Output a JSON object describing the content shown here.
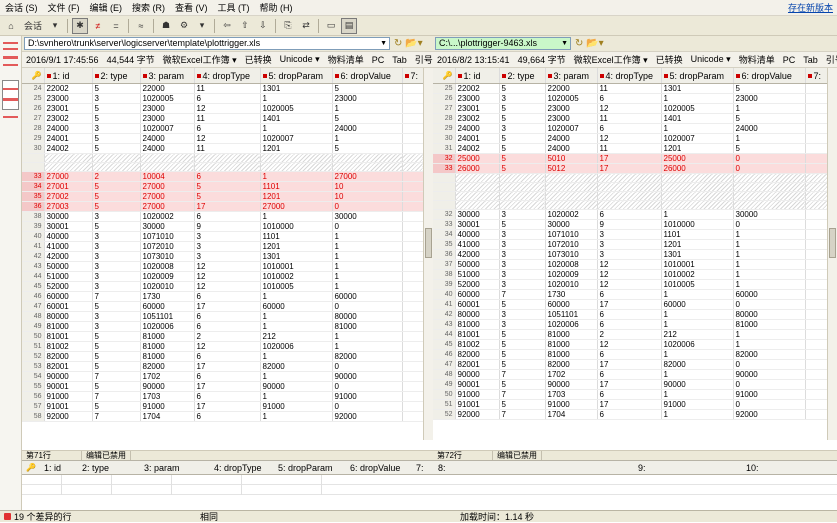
{
  "menu": {
    "items": [
      "会话 (S)",
      "文件 (F)",
      "编辑 (E)",
      "搜索 (R)",
      "查看 (V)",
      "工具 (T)",
      "帮助 (H)"
    ],
    "new_version": "存在新版本"
  },
  "toolbar": {
    "session_label": "会话"
  },
  "left": {
    "path": "D:\\svnhero\\trunk\\server\\logicserver\\template\\plottrigger.xls",
    "info": [
      "2016/9/1 17:45:56",
      "44,544 字节",
      "微软Excel工作簿 ▾",
      "已转换",
      "Unicode ▾",
      "物料清单",
      "PC",
      "Tab",
      "引号",
      "列"
    ],
    "columns": [
      "1: id",
      "2: type",
      "3: param",
      "4: dropType",
      "5: dropParam",
      "6: dropValue",
      "7:"
    ],
    "rows": [
      {
        "n": "24",
        "c": [
          "22002",
          "5",
          "22000",
          "11",
          "1301",
          "5",
          ""
        ]
      },
      {
        "n": "25",
        "c": [
          "23000",
          "3",
          "1020005",
          "6",
          "1",
          "23000",
          ""
        ]
      },
      {
        "n": "26",
        "c": [
          "23001",
          "5",
          "23000",
          "12",
          "1020005",
          "1",
          ""
        ]
      },
      {
        "n": "27",
        "c": [
          "23002",
          "5",
          "23000",
          "11",
          "1401",
          "5",
          ""
        ]
      },
      {
        "n": "28",
        "c": [
          "24000",
          "3",
          "1020007",
          "6",
          "1",
          "24000",
          ""
        ]
      },
      {
        "n": "29",
        "c": [
          "24001",
          "5",
          "24000",
          "12",
          "1020007",
          "1",
          ""
        ]
      },
      {
        "n": "30",
        "c": [
          "24002",
          "5",
          "24000",
          "11",
          "1201",
          "5",
          ""
        ]
      },
      {
        "n": "",
        "c": [
          "",
          "",
          "",
          "",
          "",
          "",
          ""
        ],
        "k": "blank"
      },
      {
        "n": "",
        "c": [
          "",
          "",
          "",
          "",
          "",
          "",
          ""
        ],
        "k": "blank"
      },
      {
        "n": "33",
        "c": [
          "27000",
          "2",
          "10004",
          "6",
          "1",
          "27000",
          ""
        ],
        "k": "diff"
      },
      {
        "n": "34",
        "c": [
          "27001",
          "5",
          "27000",
          "5",
          "1101",
          "10",
          ""
        ],
        "k": "diff"
      },
      {
        "n": "35",
        "c": [
          "27002",
          "5",
          "27000",
          "5",
          "1201",
          "10",
          ""
        ],
        "k": "diff"
      },
      {
        "n": "36",
        "c": [
          "27003",
          "5",
          "27000",
          "17",
          "27000",
          "0",
          ""
        ],
        "k": "diff"
      },
      {
        "n": "38",
        "c": [
          "30000",
          "3",
          "1020002",
          "6",
          "1",
          "30000",
          ""
        ]
      },
      {
        "n": "39",
        "c": [
          "30001",
          "5",
          "30000",
          "9",
          "1010000",
          "0",
          ""
        ]
      },
      {
        "n": "40",
        "c": [
          "40000",
          "3",
          "1071010",
          "3",
          "1101",
          "1",
          ""
        ]
      },
      {
        "n": "41",
        "c": [
          "41000",
          "3",
          "1072010",
          "3",
          "1201",
          "1",
          ""
        ]
      },
      {
        "n": "42",
        "c": [
          "42000",
          "3",
          "1073010",
          "3",
          "1301",
          "1",
          ""
        ]
      },
      {
        "n": "43",
        "c": [
          "50000",
          "3",
          "1020008",
          "12",
          "1010001",
          "1",
          ""
        ]
      },
      {
        "n": "44",
        "c": [
          "51000",
          "3",
          "1020009",
          "12",
          "1010002",
          "1",
          ""
        ]
      },
      {
        "n": "45",
        "c": [
          "52000",
          "3",
          "1020010",
          "12",
          "1010005",
          "1",
          ""
        ]
      },
      {
        "n": "46",
        "c": [
          "60000",
          "7",
          "1730",
          "6",
          "1",
          "60000",
          ""
        ]
      },
      {
        "n": "47",
        "c": [
          "60001",
          "5",
          "60000",
          "17",
          "60000",
          "0",
          ""
        ]
      },
      {
        "n": "48",
        "c": [
          "80000",
          "3",
          "1051101",
          "6",
          "1",
          "80000",
          ""
        ]
      },
      {
        "n": "49",
        "c": [
          "81000",
          "3",
          "1020006",
          "6",
          "1",
          "81000",
          ""
        ]
      },
      {
        "n": "50",
        "c": [
          "81001",
          "5",
          "81000",
          "2",
          "212",
          "1",
          ""
        ]
      },
      {
        "n": "51",
        "c": [
          "81002",
          "5",
          "81000",
          "12",
          "1020006",
          "1",
          ""
        ]
      },
      {
        "n": "52",
        "c": [
          "82000",
          "5",
          "81000",
          "6",
          "1",
          "82000",
          ""
        ]
      },
      {
        "n": "53",
        "c": [
          "82001",
          "5",
          "82000",
          "17",
          "82000",
          "0",
          ""
        ]
      },
      {
        "n": "54",
        "c": [
          "90000",
          "7",
          "1702",
          "6",
          "1",
          "90000",
          ""
        ]
      },
      {
        "n": "55",
        "c": [
          "90001",
          "5",
          "90000",
          "17",
          "90000",
          "0",
          ""
        ]
      },
      {
        "n": "56",
        "c": [
          "91000",
          "7",
          "1703",
          "6",
          "1",
          "91000",
          ""
        ]
      },
      {
        "n": "57",
        "c": [
          "91001",
          "5",
          "91000",
          "17",
          "91000",
          "0",
          ""
        ]
      },
      {
        "n": "58",
        "c": [
          "92000",
          "7",
          "1704",
          "6",
          "1",
          "92000",
          ""
        ]
      }
    ],
    "status": [
      "第71行",
      "编辑已禁用"
    ]
  },
  "right": {
    "path": "C:\\...\\plottrigger-9463.xls",
    "info": [
      "2016/8/2 13:15:41",
      "49,664 字节",
      "微软Excel工作簿 ▾",
      "已转换",
      "Unicode ▾",
      "物料清单",
      "PC",
      "Tab",
      "引号"
    ],
    "columns": [
      "1: id",
      "2: type",
      "3: param",
      "4: dropType",
      "5: dropParam",
      "6: dropValue",
      "7:"
    ],
    "rows": [
      {
        "n": "25",
        "c": [
          "22002",
          "5",
          "22000",
          "11",
          "1301",
          "5",
          ""
        ]
      },
      {
        "n": "26",
        "c": [
          "23000",
          "3",
          "1020005",
          "6",
          "1",
          "23000",
          ""
        ]
      },
      {
        "n": "27",
        "c": [
          "23001",
          "5",
          "23000",
          "12",
          "1020005",
          "1",
          ""
        ]
      },
      {
        "n": "28",
        "c": [
          "23002",
          "5",
          "23000",
          "11",
          "1401",
          "5",
          ""
        ]
      },
      {
        "n": "29",
        "c": [
          "24000",
          "3",
          "1020007",
          "6",
          "1",
          "24000",
          ""
        ]
      },
      {
        "n": "30",
        "c": [
          "24001",
          "5",
          "24000",
          "12",
          "1020007",
          "1",
          ""
        ]
      },
      {
        "n": "31",
        "c": [
          "24002",
          "5",
          "24000",
          "11",
          "1201",
          "5",
          ""
        ]
      },
      {
        "n": "32",
        "c": [
          "25000",
          "5",
          "5010",
          "17",
          "25000",
          "0",
          ""
        ],
        "k": "diff"
      },
      {
        "n": "33",
        "c": [
          "26000",
          "5",
          "5012",
          "17",
          "26000",
          "0",
          ""
        ],
        "k": "diff"
      },
      {
        "n": "",
        "c": [
          "",
          "",
          "",
          "",
          "",
          "",
          ""
        ],
        "k": "blank"
      },
      {
        "n": "",
        "c": [
          "",
          "",
          "",
          "",
          "",
          "",
          ""
        ],
        "k": "blank"
      },
      {
        "n": "",
        "c": [
          "",
          "",
          "",
          "",
          "",
          "",
          ""
        ],
        "k": "blank"
      },
      {
        "n": "",
        "c": [
          "",
          "",
          "",
          "",
          "",
          "",
          ""
        ],
        "k": "blank"
      },
      {
        "n": "32",
        "c": [
          "30000",
          "3",
          "1020002",
          "6",
          "1",
          "30000",
          ""
        ]
      },
      {
        "n": "33",
        "c": [
          "30001",
          "5",
          "30000",
          "9",
          "1010000",
          "0",
          ""
        ]
      },
      {
        "n": "34",
        "c": [
          "40000",
          "3",
          "1071010",
          "3",
          "1101",
          "1",
          ""
        ]
      },
      {
        "n": "35",
        "c": [
          "41000",
          "3",
          "1072010",
          "3",
          "1201",
          "1",
          ""
        ]
      },
      {
        "n": "36",
        "c": [
          "42000",
          "3",
          "1073010",
          "3",
          "1301",
          "1",
          ""
        ]
      },
      {
        "n": "37",
        "c": [
          "50000",
          "3",
          "1020008",
          "12",
          "1010001",
          "1",
          ""
        ]
      },
      {
        "n": "38",
        "c": [
          "51000",
          "3",
          "1020009",
          "12",
          "1010002",
          "1",
          ""
        ]
      },
      {
        "n": "39",
        "c": [
          "52000",
          "3",
          "1020010",
          "12",
          "1010005",
          "1",
          ""
        ]
      },
      {
        "n": "40",
        "c": [
          "60000",
          "7",
          "1730",
          "6",
          "1",
          "60000",
          ""
        ]
      },
      {
        "n": "41",
        "c": [
          "60001",
          "5",
          "60000",
          "17",
          "60000",
          "0",
          ""
        ]
      },
      {
        "n": "42",
        "c": [
          "80000",
          "3",
          "1051101",
          "6",
          "1",
          "80000",
          ""
        ]
      },
      {
        "n": "43",
        "c": [
          "81000",
          "3",
          "1020006",
          "6",
          "1",
          "81000",
          ""
        ]
      },
      {
        "n": "44",
        "c": [
          "81001",
          "5",
          "81000",
          "2",
          "212",
          "1",
          ""
        ]
      },
      {
        "n": "45",
        "c": [
          "81002",
          "5",
          "81000",
          "12",
          "1020006",
          "1",
          ""
        ]
      },
      {
        "n": "46",
        "c": [
          "82000",
          "5",
          "81000",
          "6",
          "1",
          "82000",
          ""
        ]
      },
      {
        "n": "47",
        "c": [
          "82001",
          "5",
          "82000",
          "17",
          "82000",
          "0",
          ""
        ]
      },
      {
        "n": "48",
        "c": [
          "90000",
          "7",
          "1702",
          "6",
          "1",
          "90000",
          ""
        ]
      },
      {
        "n": "49",
        "c": [
          "90001",
          "5",
          "90000",
          "17",
          "90000",
          "0",
          ""
        ]
      },
      {
        "n": "50",
        "c": [
          "91000",
          "7",
          "1703",
          "6",
          "1",
          "91000",
          ""
        ]
      },
      {
        "n": "51",
        "c": [
          "91001",
          "5",
          "91000",
          "17",
          "91000",
          "0",
          ""
        ]
      },
      {
        "n": "52",
        "c": [
          "92000",
          "7",
          "1704",
          "6",
          "1",
          "92000",
          ""
        ]
      }
    ],
    "status": [
      "第72行",
      "编辑已禁用"
    ]
  },
  "detail": {
    "columns": [
      "1: id",
      "2: type",
      "3: param",
      "4: dropType",
      "5: dropParam",
      "6: dropValue",
      "7:",
      "8:",
      "9:",
      "10:"
    ]
  },
  "footer": {
    "diff_count": "19 个差异的行",
    "same": "相同",
    "load_time": "加载时间：1.14 秒"
  },
  "colors": {
    "diff_bg": "#fbdcdc",
    "diff_text": "#dd0000",
    "path_green": "#c9f7c9",
    "accent_link": "#0645ad"
  }
}
